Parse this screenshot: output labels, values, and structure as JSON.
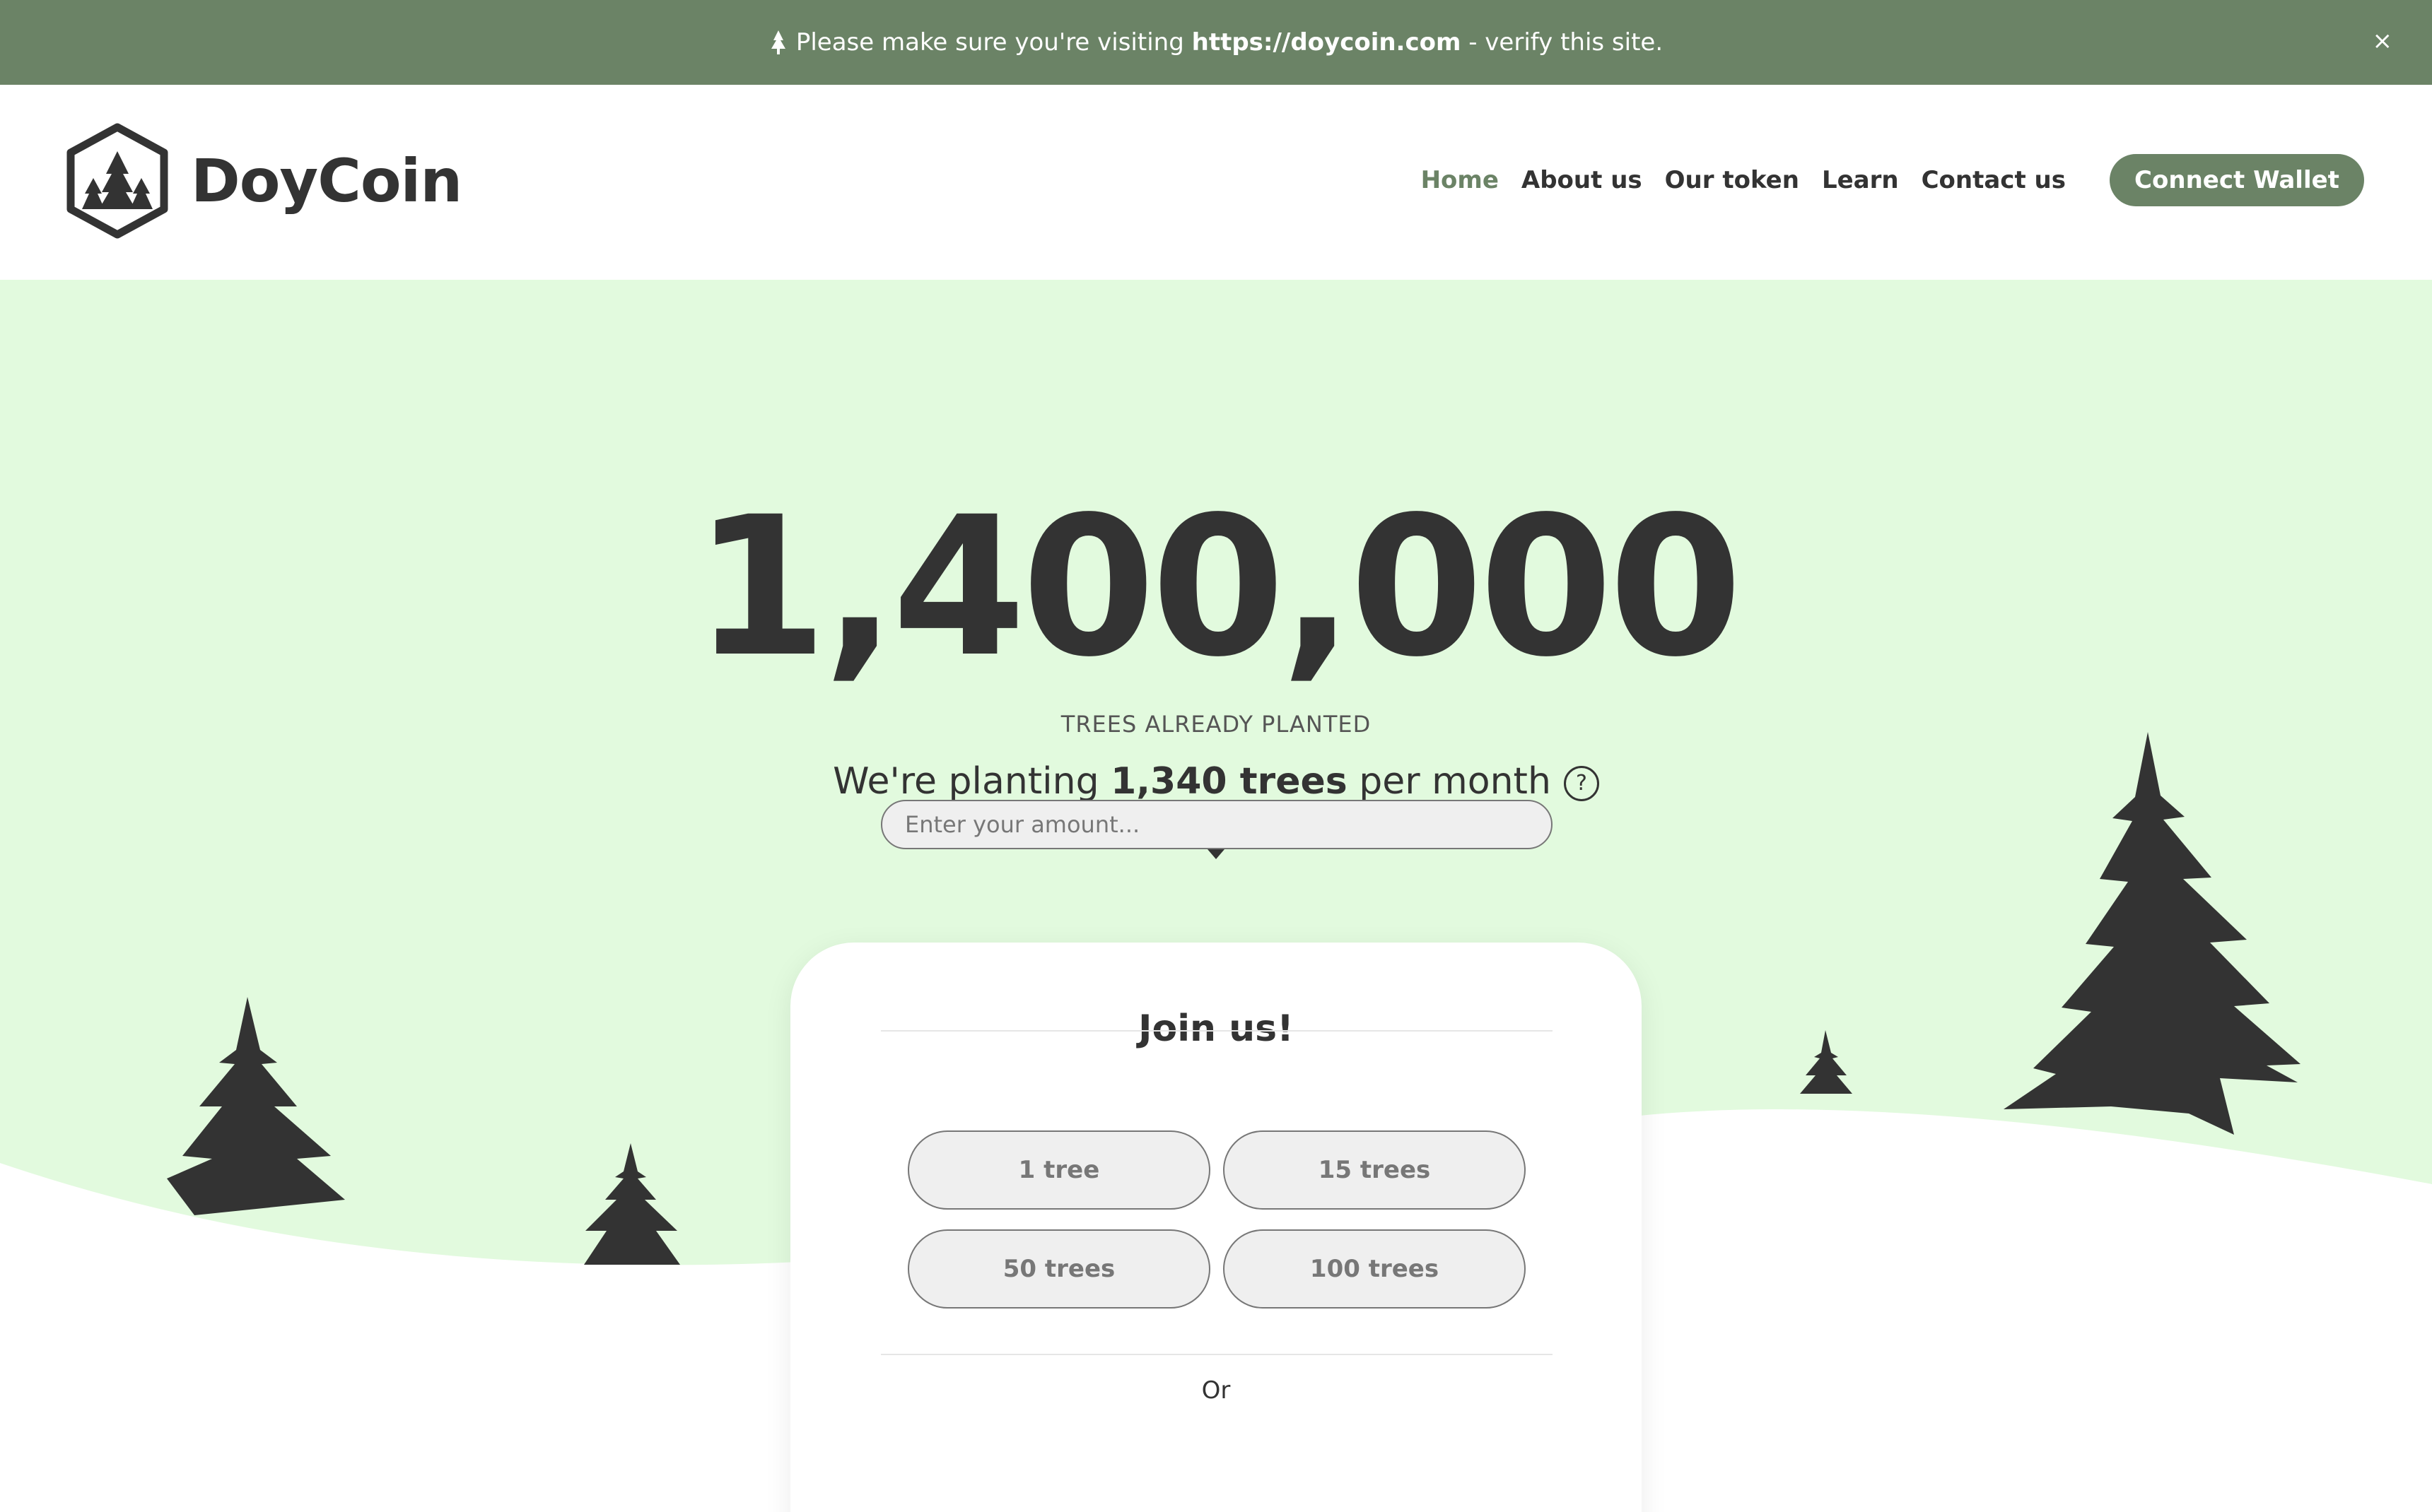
{
  "banner": {
    "prefix": "Please make sure you're visiting",
    "url": "https://doycoin.com",
    "suffix": "- verify this site.",
    "close_label": "×"
  },
  "header": {
    "brand": "DoyCoin",
    "nav": [
      "Home",
      "About us",
      "Our token",
      "Learn",
      "Contact us"
    ],
    "active_nav": "Home",
    "connect_label": "Connect Wallet"
  },
  "hero": {
    "count": "1,400,000",
    "count_label": "TREES ALREADY PLANTED",
    "rate_prefix": "We're planting",
    "rate_value": "1,340 trees",
    "rate_suffix": "per month",
    "help_label": "?"
  },
  "join": {
    "title": "Join us!",
    "options": [
      "1 tree",
      "15 trees",
      "50 trees",
      "100 trees"
    ],
    "or_label": "Or",
    "amount_placeholder": "Enter your amount..."
  },
  "colors": {
    "accent": "#6b8366",
    "hero_bg": "#e2fade",
    "text": "#333333",
    "tree": "#333333"
  }
}
